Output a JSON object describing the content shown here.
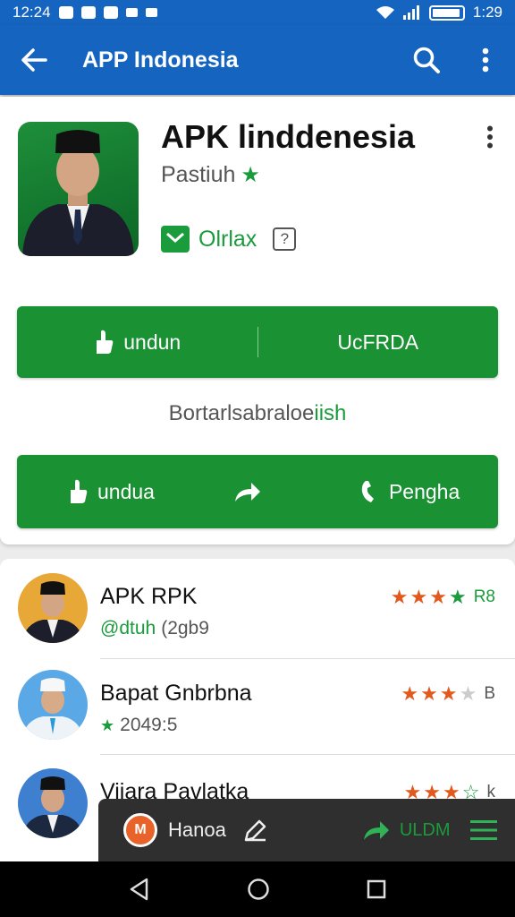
{
  "status_bar": {
    "time": "12:24",
    "clock_right": "1:29"
  },
  "app_bar": {
    "title": "APP Indonesia"
  },
  "hero": {
    "title": "APK linddenesia",
    "subtitle": "Pastiuh",
    "tag": "Olrlax",
    "tag_help": "?",
    "button_row1": {
      "left": "undun",
      "right": "UcFRDA"
    },
    "middle_text_main": "Bortarlsabraloe",
    "middle_text_green": "iish",
    "button_row2": {
      "left": "undua",
      "right": "Pengha"
    }
  },
  "list": [
    {
      "title": "APK RPK",
      "sub_green": "@dtuh",
      "sub_rest": "(2gb9",
      "stars_on": 3,
      "stars_green": 1,
      "stars_off": 0,
      "rating": "R8"
    },
    {
      "title": "Bapat Gnbrbna",
      "sub_green": "",
      "sub_rest": "2049:5",
      "stars_on": 3,
      "stars_green": 0,
      "stars_off": 1,
      "rating": "B"
    },
    {
      "title": "Viiara Pavlatka",
      "sub_green": "",
      "sub_rest": "",
      "stars_on": 3,
      "stars_green": 1,
      "stars_off": 0,
      "rating": "k"
    }
  ],
  "toolbar": {
    "label": "Hanoa",
    "status": "ULDM"
  },
  "colors": {
    "primary": "#1565c0",
    "accent_green": "#1a9133",
    "star_orange": "#e2591e"
  },
  "icons": [
    "back-arrow-icon",
    "search-icon",
    "more-vert-icon",
    "star-icon",
    "mail-icon",
    "help-icon",
    "thumb-up-icon",
    "share-icon",
    "phone-icon",
    "edit-icon",
    "hamburger-icon",
    "nav-back-icon",
    "nav-home-icon",
    "nav-recent-icon"
  ]
}
